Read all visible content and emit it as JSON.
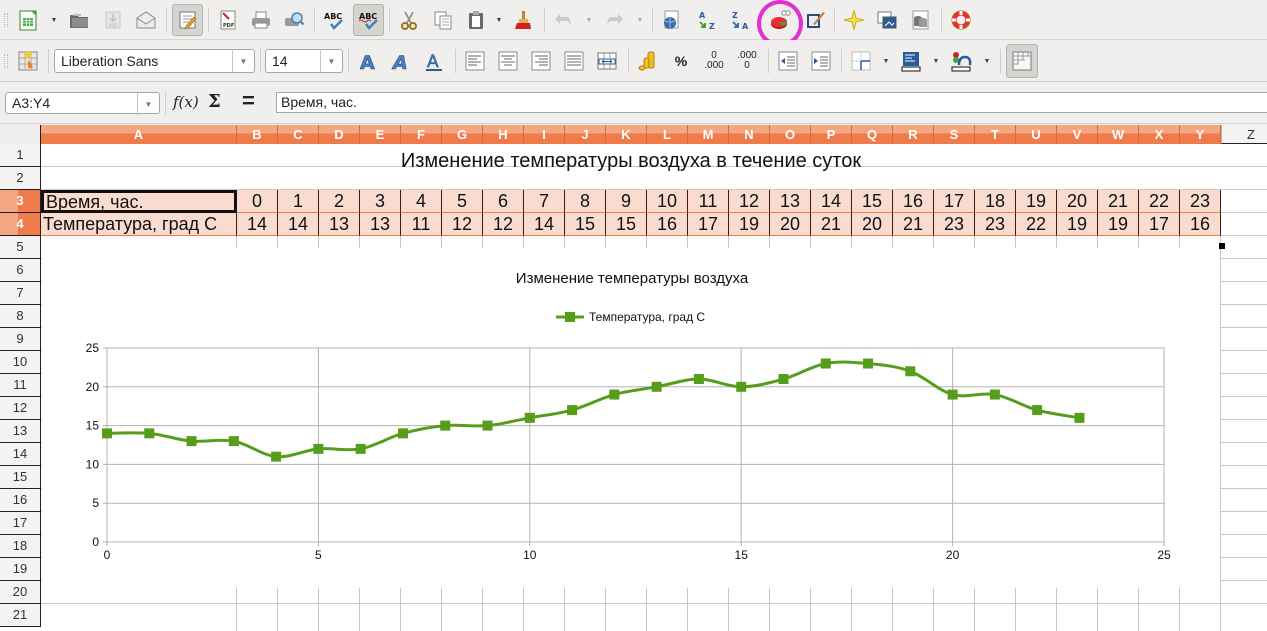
{
  "toolbar_standard": {
    "buttons": [
      {
        "name": "new-spreadsheet",
        "icon": "spreadsheet-icon"
      },
      {
        "name": "open",
        "icon": "folder-open-icon"
      },
      {
        "name": "save",
        "icon": "save-icon",
        "disabled": true
      },
      {
        "name": "email",
        "icon": "envelope-icon"
      },
      {
        "name": "edit-file",
        "icon": "edit-pencil-icon",
        "active": true
      },
      {
        "name": "export-pdf",
        "icon": "pdf-icon"
      },
      {
        "name": "print",
        "icon": "printer-icon"
      },
      {
        "name": "print-preview",
        "icon": "print-preview-icon"
      },
      {
        "name": "spellcheck",
        "icon": "spellcheck-icon"
      },
      {
        "name": "autospellcheck",
        "icon": "autospellcheck-icon",
        "active": true
      },
      {
        "name": "cut",
        "icon": "scissors-icon"
      },
      {
        "name": "copy",
        "icon": "copy-icon"
      },
      {
        "name": "paste",
        "icon": "clipboard-icon"
      },
      {
        "name": "clone-formatting",
        "icon": "paintbrush-icon"
      },
      {
        "name": "undo",
        "icon": "undo-icon",
        "disabled": true
      },
      {
        "name": "redo",
        "icon": "redo-icon",
        "disabled": true
      },
      {
        "name": "hyperlink",
        "icon": "globe-icon"
      },
      {
        "name": "sort-ascending",
        "icon": "sort-az-icon"
      },
      {
        "name": "sort-descending",
        "icon": "sort-za-icon"
      },
      {
        "name": "insert-chart",
        "icon": "chart-pie-icon",
        "highlighted": true
      },
      {
        "name": "show-draw-functions",
        "icon": "draw-functions-icon"
      },
      {
        "name": "navigator",
        "icon": "navigator-star-icon"
      },
      {
        "name": "gallery",
        "icon": "gallery-icon"
      },
      {
        "name": "data-sources",
        "icon": "database-icon"
      },
      {
        "name": "help",
        "icon": "lifebuoy-icon"
      }
    ],
    "pdf_label": "PDF",
    "abc_label": "ABC"
  },
  "toolbar_formatting": {
    "font_name": "Liberation Sans",
    "font_size": "14",
    "percent_label": "%",
    "add_decimal_top": "0",
    "add_decimal_bottom": ".000",
    "del_decimal_top": ".000",
    "del_decimal_bottom": "0"
  },
  "formula_bar": {
    "name_box": "A3:Y4",
    "fx_label": "f(x)",
    "sum_label": "Σ",
    "equals_label": "=",
    "content": "Время, час."
  },
  "sheet": {
    "columns": [
      "A",
      "B",
      "C",
      "D",
      "E",
      "F",
      "G",
      "H",
      "I",
      "J",
      "K",
      "L",
      "M",
      "N",
      "O",
      "P",
      "Q",
      "R",
      "S",
      "T",
      "U",
      "V",
      "W",
      "X",
      "Y",
      "Z"
    ],
    "rows": [
      "1",
      "2",
      "3",
      "4",
      "5",
      "6",
      "7",
      "8",
      "9",
      "10",
      "11",
      "12",
      "13",
      "14",
      "15",
      "16",
      "17",
      "18",
      "19",
      "20",
      "21"
    ],
    "title": "Изменение температуры воздуха в течение суток",
    "row3_label": "Время, час.",
    "row4_label": "Температура, град С",
    "hours": [
      "0",
      "1",
      "2",
      "3",
      "4",
      "5",
      "6",
      "7",
      "8",
      "9",
      "10",
      "11",
      "12",
      "13",
      "14",
      "15",
      "16",
      "17",
      "18",
      "19",
      "20",
      "21",
      "22",
      "23"
    ],
    "temperatures": [
      "14",
      "14",
      "13",
      "13",
      "11",
      "12",
      "12",
      "14",
      "15",
      "15",
      "16",
      "17",
      "19",
      "20",
      "21",
      "20",
      "21",
      "23",
      "23",
      "22",
      "19",
      "19",
      "17",
      "16"
    ]
  },
  "colors": {
    "header_selected": "#ef7a4a",
    "selection_fill": "#fadbd0",
    "series": "#579d1c",
    "highlight_circle": "#e030d0"
  },
  "chart_data": {
    "type": "line",
    "title": "Изменение температуры воздуха",
    "legend": {
      "entries": [
        "Температура, град С"
      ],
      "placement": "top"
    },
    "xlabel": "",
    "ylabel": "",
    "xlim": [
      0,
      25
    ],
    "ylim": [
      0,
      25
    ],
    "xticks": [
      "0",
      "5",
      "10",
      "15",
      "20",
      "25"
    ],
    "yticks": [
      "0",
      "5",
      "10",
      "15",
      "20",
      "25"
    ],
    "grid": true,
    "smooth": true,
    "marker": "square",
    "series": [
      {
        "name": "Температура, град С",
        "x": [
          0,
          1,
          2,
          3,
          4,
          5,
          6,
          7,
          8,
          9,
          10,
          11,
          12,
          13,
          14,
          15,
          16,
          17,
          18,
          19,
          20,
          21,
          22,
          23
        ],
        "y": [
          14,
          14,
          13,
          13,
          11,
          12,
          12,
          14,
          15,
          15,
          16,
          17,
          19,
          20,
          21,
          20,
          21,
          23,
          23,
          22,
          19,
          19,
          17,
          16
        ]
      }
    ]
  }
}
